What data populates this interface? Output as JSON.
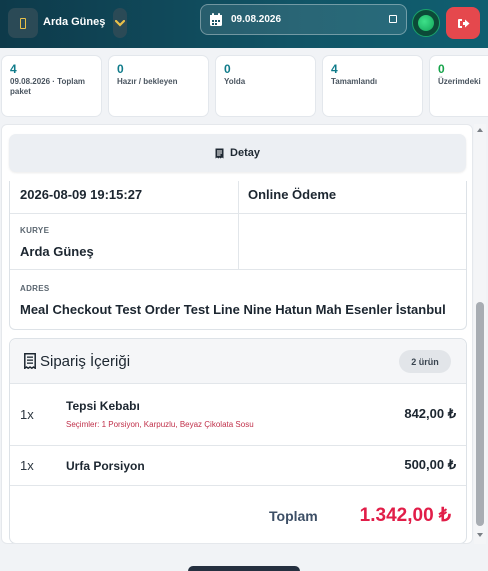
{
  "header": {
    "user_name": "Arda Güneş",
    "date_value": "09.08.2026",
    "icons": {
      "logo": "package-icon",
      "user_menu": "chevron-down-icon",
      "date": "calendar-icon",
      "status": "online-status-icon",
      "logout": "logout-icon"
    },
    "colors": {
      "accent": "#e8c04a",
      "logout_bg": "#e5484d",
      "online": "#1fc36a"
    }
  },
  "stats": [
    {
      "value": "4",
      "label": "09.08.2026 · Toplam paket"
    },
    {
      "value": "0",
      "label": "Hazır / bekleyen"
    },
    {
      "value": "0",
      "label": "Yolda"
    },
    {
      "value": "4",
      "label": "Tamamlandı"
    },
    {
      "value": "0",
      "label": "Üzerimdeki"
    }
  ],
  "detail": {
    "tab_label": "Detay",
    "order_datetime": "2026-08-09 19:15:27",
    "payment_method": "Online Ödeme",
    "courier_caption": "KURYE",
    "courier_name": "Arda Güneş",
    "address_caption": "ADRES",
    "address": "Meal Checkout Test Order Test Line Nine Hatun Mah Esenler İstanbul"
  },
  "order": {
    "title": "Sipariş İçeriği",
    "count_badge": "2 ürün",
    "items": [
      {
        "qty": "1x",
        "name": "Tepsi Kebabı",
        "options": "Seçimler: 1 Porsiyon, Karpuzlu, Beyaz Çikolata Sosu",
        "price": "842,00 ₺"
      },
      {
        "qty": "1x",
        "name": "Urfa Porsiyon",
        "options": "",
        "price": "500,00 ₺"
      }
    ],
    "total_label": "Toplam",
    "total_value": "1.342,00 ₺",
    "total_color": "#e11d48"
  }
}
